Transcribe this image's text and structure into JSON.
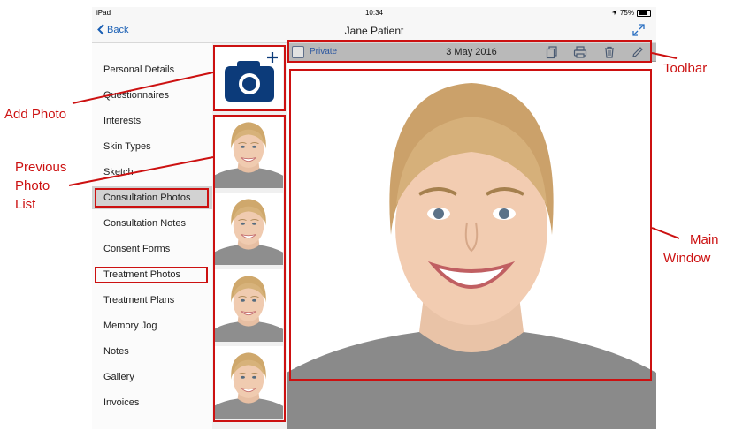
{
  "status_bar": {
    "device": "iPad",
    "time": "10:34",
    "battery": "75%"
  },
  "nav": {
    "back_label": "Back",
    "title": "Jane Patient"
  },
  "sidebar": {
    "items": [
      {
        "label": "Personal Details"
      },
      {
        "label": "Questionnaires"
      },
      {
        "label": "Interests"
      },
      {
        "label": "Skin Types"
      },
      {
        "label": "Sketch"
      },
      {
        "label": "Consultation Photos",
        "selected": true
      },
      {
        "label": "Consultation Notes"
      },
      {
        "label": "Consent Forms"
      },
      {
        "label": "Treatment Photos"
      },
      {
        "label": "Treatment Plans"
      },
      {
        "label": "Memory Jog"
      },
      {
        "label": "Notes"
      },
      {
        "label": "Gallery"
      },
      {
        "label": "Invoices"
      }
    ]
  },
  "toolbar": {
    "private_label": "Private",
    "private_checked": false,
    "date": "3 May 2016",
    "icons": [
      "copy-icon",
      "print-icon",
      "trash-icon",
      "pencil-icon"
    ]
  },
  "annotations": {
    "toolbar": "Toolbar",
    "add_photo": "Add Photo",
    "previous_photo_list": [
      "Previous",
      "Photo",
      "List"
    ],
    "main_window": [
      "Main",
      "Window"
    ]
  },
  "colors": {
    "annotation": "#cc1111",
    "selected_row": "#d2d2d2",
    "toolbar_bg": "#b9b9b9",
    "camera_blue": "#0c3b7a",
    "link_blue": "#1a5fb4"
  }
}
